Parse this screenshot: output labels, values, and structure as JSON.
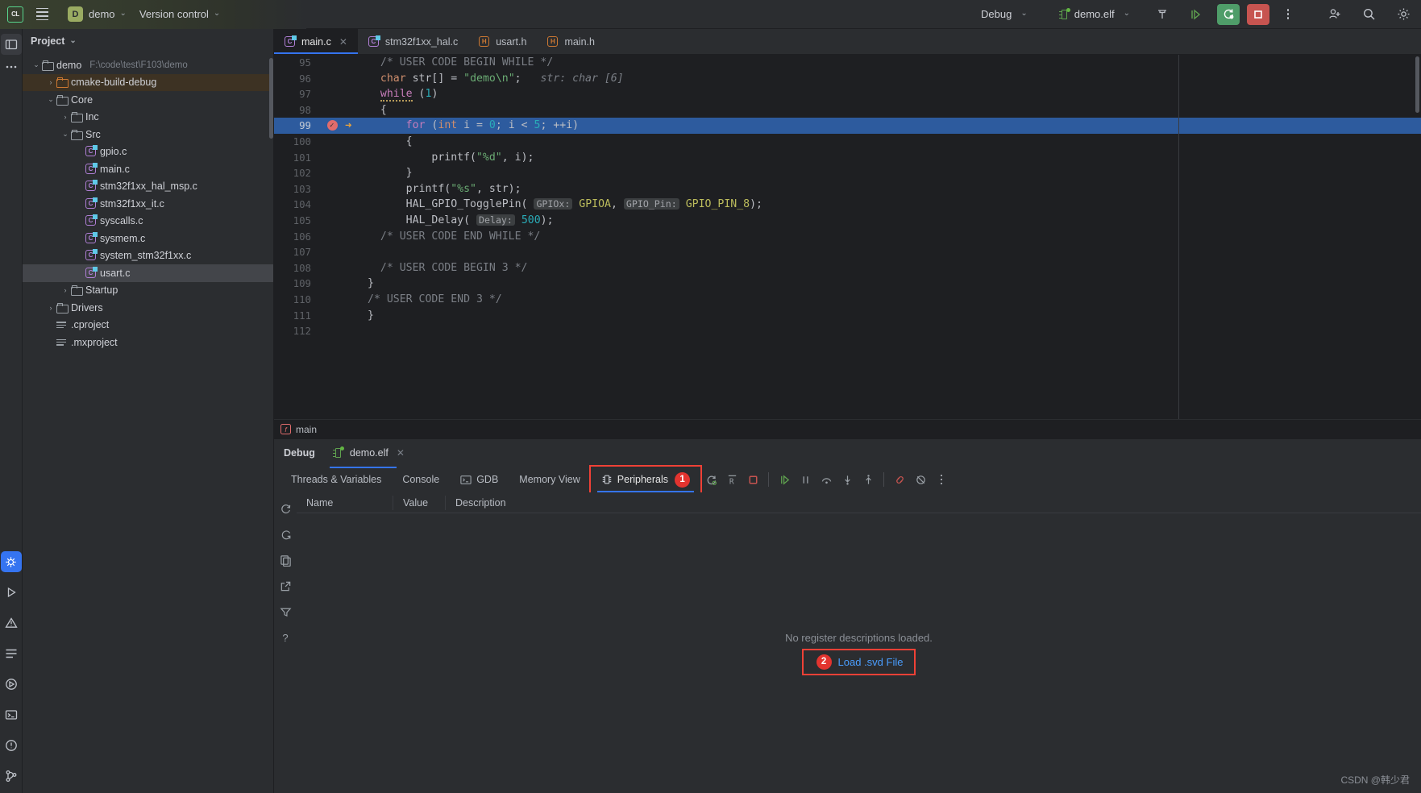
{
  "titlebar": {
    "ide_logo": "CL",
    "menu_icon": "hamburger-icon",
    "project_badge": "D",
    "project_name": "demo",
    "vcs_label": "Version control",
    "run_config": "Debug",
    "target_name": "demo.elf",
    "icons": [
      "build-hammer-icon",
      "run-icon",
      "debug-restart-icon",
      "stop-icon",
      "more-vertical-icon",
      "add-user-icon",
      "search-icon",
      "settings-gear-icon"
    ]
  },
  "left_rail": {
    "items": [
      "project-window-icon",
      "more-tool-windows-icon",
      "debug-window-icon",
      "run-window-icon",
      "problems-icon",
      "todo-icon",
      "services-icon",
      "terminal-icon",
      "notifications-icon",
      "git-branch-icon"
    ]
  },
  "project_pane": {
    "header": "Project",
    "tree": [
      {
        "label": "demo",
        "path": "F:\\code\\test\\F103\\demo",
        "icon": "module-folder-icon",
        "indent": 0,
        "arrow": "down",
        "state": "normal"
      },
      {
        "label": "cmake-build-debug",
        "path": "",
        "icon": "excluded-folder-icon",
        "indent": 1,
        "arrow": "right",
        "state": "highlight"
      },
      {
        "label": "Core",
        "path": "",
        "icon": "folder-icon",
        "indent": 1,
        "arrow": "down",
        "state": "normal"
      },
      {
        "label": "Inc",
        "path": "",
        "icon": "folder-icon",
        "indent": 2,
        "arrow": "right",
        "state": "normal"
      },
      {
        "label": "Src",
        "path": "",
        "icon": "folder-icon",
        "indent": 2,
        "arrow": "down",
        "state": "normal"
      },
      {
        "label": "gpio.c",
        "path": "",
        "icon": "c-file-icon",
        "indent": 3,
        "arrow": "none",
        "state": "normal"
      },
      {
        "label": "main.c",
        "path": "",
        "icon": "c-file-icon",
        "indent": 3,
        "arrow": "none",
        "state": "normal"
      },
      {
        "label": "stm32f1xx_hal_msp.c",
        "path": "",
        "icon": "c-file-icon",
        "indent": 3,
        "arrow": "none",
        "state": "normal"
      },
      {
        "label": "stm32f1xx_it.c",
        "path": "",
        "icon": "c-file-icon",
        "indent": 3,
        "arrow": "none",
        "state": "normal"
      },
      {
        "label": "syscalls.c",
        "path": "",
        "icon": "c-file-icon",
        "indent": 3,
        "arrow": "none",
        "state": "normal"
      },
      {
        "label": "sysmem.c",
        "path": "",
        "icon": "c-file-icon",
        "indent": 3,
        "arrow": "none",
        "state": "normal"
      },
      {
        "label": "system_stm32f1xx.c",
        "path": "",
        "icon": "c-file-icon",
        "indent": 3,
        "arrow": "none",
        "state": "normal"
      },
      {
        "label": "usart.c",
        "path": "",
        "icon": "c-file-icon",
        "indent": 3,
        "arrow": "none",
        "state": "selected"
      },
      {
        "label": "Startup",
        "path": "",
        "icon": "folder-icon",
        "indent": 2,
        "arrow": "right",
        "state": "normal"
      },
      {
        "label": "Drivers",
        "path": "",
        "icon": "folder-icon",
        "indent": 1,
        "arrow": "right",
        "state": "normal"
      },
      {
        "label": ".cproject",
        "path": "",
        "icon": "text-file-icon",
        "indent": 1,
        "arrow": "none",
        "state": "normal"
      },
      {
        "label": ".mxproject",
        "path": "",
        "icon": "text-file-icon",
        "indent": 1,
        "arrow": "none",
        "state": "normal"
      }
    ]
  },
  "editor": {
    "tabs": [
      {
        "label": "main.c",
        "icon": "c-file-icon",
        "active": true,
        "closable": true
      },
      {
        "label": "stm32f1xx_hal.c",
        "icon": "c-file-icon",
        "active": false,
        "closable": false
      },
      {
        "label": "usart.h",
        "icon": "h-file-icon",
        "active": false,
        "closable": false
      },
      {
        "label": "main.h",
        "icon": "h-file-icon",
        "active": false,
        "closable": false
      }
    ],
    "breadcrumb": "main",
    "breadcrumb_icon": "function-icon",
    "lines": [
      {
        "num": "95",
        "text": "  /* USER CODE BEGIN WHILE */"
      },
      {
        "num": "96",
        "text": "  char str[] = \"demo\\n\";   str: char [6]"
      },
      {
        "num": "97",
        "text": "  while (1)"
      },
      {
        "num": "98",
        "text": "  {"
      },
      {
        "num": "99",
        "text": "      for (int i = 0; i < 5; ++i)",
        "current": true,
        "breakpoint": true,
        "exec_arrow": true
      },
      {
        "num": "100",
        "text": "      {"
      },
      {
        "num": "101",
        "text": "          printf(\"%d\", i);"
      },
      {
        "num": "102",
        "text": "      }"
      },
      {
        "num": "103",
        "text": "      printf(\"%s\", str);"
      },
      {
        "num": "104",
        "text": "      HAL_GPIO_TogglePin( GPIOx: GPIOA, GPIO_Pin: GPIO_PIN_8);"
      },
      {
        "num": "105",
        "text": "      HAL_Delay( Delay: 500);"
      },
      {
        "num": "106",
        "text": "  /* USER CODE END WHILE */"
      },
      {
        "num": "107",
        "text": ""
      },
      {
        "num": "108",
        "text": "  /* USER CODE BEGIN 3 */"
      },
      {
        "num": "109",
        "text": "}"
      },
      {
        "num": "110",
        "text": "/* USER CODE END 3 */"
      },
      {
        "num": "111",
        "text": "}"
      },
      {
        "num": "112",
        "text": ""
      }
    ]
  },
  "debug_panel": {
    "title": "Debug",
    "session": "demo.elf",
    "session_icon": "chip-icon",
    "close_icon": "close-icon",
    "tabs": [
      {
        "label": "Threads & Variables",
        "icon": "",
        "active": false
      },
      {
        "label": "Console",
        "icon": "",
        "active": false
      },
      {
        "label": "GDB",
        "icon": "gdb-console-icon",
        "active": false
      },
      {
        "label": "Memory View",
        "icon": "",
        "active": false
      },
      {
        "label": "Peripherals",
        "icon": "peripherals-icon",
        "active": true,
        "badge": "1",
        "outlined": true
      }
    ],
    "toolbar_icons": [
      "rerun-icon",
      "restart-r-icon",
      "stop-icon",
      "resume-icon",
      "pause-icon",
      "step-over-icon",
      "step-into-icon",
      "step-out-icon",
      "mute-breakpoints-icon",
      "view-breakpoints-icon",
      "more-vertical-icon"
    ],
    "side_rail_icons": [
      "refresh-icon",
      "restore-layout-icon",
      "copy-icon",
      "export-icon",
      "filter-icon",
      "help-icon"
    ],
    "columns": [
      "Name",
      "Value",
      "Description"
    ],
    "empty_message": "No register descriptions loaded.",
    "load_svd_label": "Load .svd File",
    "load_svd_badge": "2"
  },
  "watermark": "CSDN @韩少君",
  "colors": {
    "accent_blue": "#3574f0",
    "annotation_red": "#ef4136",
    "badge_red": "#e3342f",
    "run_green": "#4f9d69",
    "stop_red": "#c75450",
    "current_line": "#2d5b9e",
    "link_blue": "#4a9eff"
  }
}
